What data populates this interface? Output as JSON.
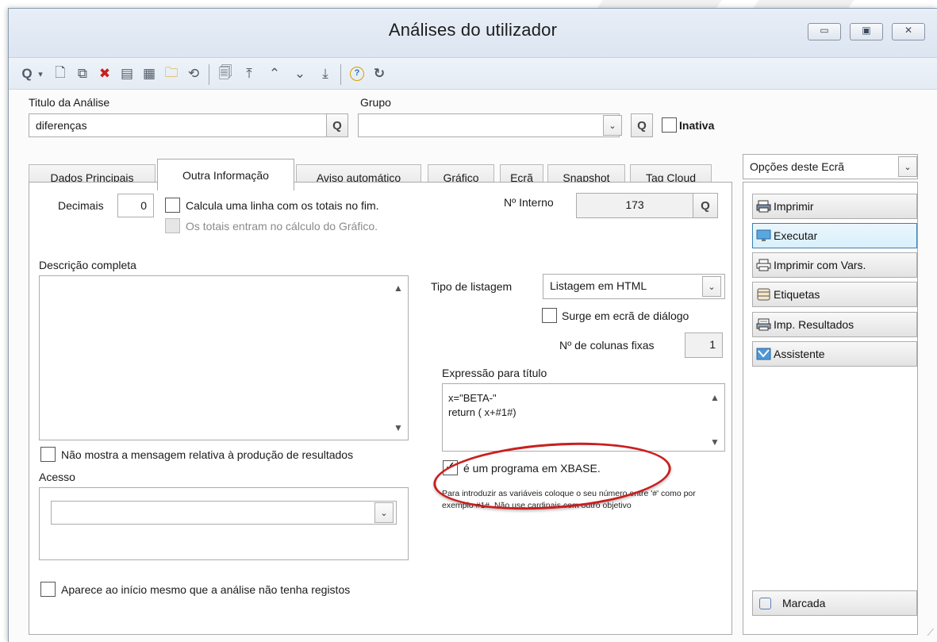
{
  "window": {
    "title": "Análises do utilizador",
    "minimize_glyph": "▭",
    "maximize_glyph": "▣",
    "close_glyph": "✕"
  },
  "toolbar": {
    "search_icon": "search-icon",
    "search_glyph": "Q",
    "dropdown_glyph": "▾",
    "new_glyph": "🗋",
    "copy_glyph": "⧉",
    "delete_glyph": "✖",
    "delete_color": "#c8201f",
    "list_glyph": "▤",
    "grid_glyph": "▦",
    "find_glyph": "🗀",
    "refresh_glyph": "⟲",
    "preview_glyph": "🗐",
    "first_glyph": "⤒",
    "prev_glyph": "⌃",
    "next_glyph": "⌄",
    "last_glyph": "⤓",
    "help_glyph": "?",
    "reload_glyph": "↻"
  },
  "form": {
    "titulo_label": "Titulo da Análise",
    "titulo_value": "diferenças",
    "grupo_label": "Grupo",
    "grupo_value": "",
    "inativa_label": "Inativa",
    "lookup_glyph": "Q",
    "combo_glyph": "⌄"
  },
  "tabs": [
    {
      "label": "Dados Principais"
    },
    {
      "label": "Outra Informação"
    },
    {
      "label": "Aviso automático"
    },
    {
      "label": "Gráfico"
    },
    {
      "label": "Ecrã"
    },
    {
      "label": "Snapshot"
    },
    {
      "label": "Tag Cloud"
    }
  ],
  "active_tab": "Outra Informação",
  "panel": {
    "decimais_label": "Decimais",
    "decimais_value": "0",
    "calcula_totais_label": "Calcula uma linha com os totais no fim.",
    "totais_grafico_label": "Os totais entram no cálculo do Gráfico.",
    "n_interno_label": "Nº Interno",
    "n_interno_value": "173",
    "descricao_label": "Descrição completa",
    "descricao_value": "",
    "tipo_listagem_label": "Tipo de listagem",
    "tipo_listagem_value": "Listagem em HTML",
    "surge_dialogo_label": "Surge em ecrã de diálogo",
    "colunas_fixas_label": "Nº de colunas fixas",
    "colunas_fixas_value": "1",
    "expressao_label": "Expressão para título",
    "expressao_line1": "x=\"BETA-\"",
    "expressao_line2": "return ( x+#1#)",
    "xbase_label": "é um programa em XBASE.",
    "xbase_checked": true,
    "xbase_check_glyph": "✓",
    "hint_text": "Para introduzir as variáveis coloque o seu número entre '#' como por exemplo #1#. Não use cardinais com outro objetivo",
    "nao_mostra_label": "Não mostra a mensagem relativa à produção de resultados",
    "acesso_label": "Acesso",
    "acesso_value": "",
    "aparece_inicio_label": "Aparece ao início mesmo que a análise não tenha registos",
    "highlight_color": "#c8201f"
  },
  "sidebar": {
    "options_label": "Opções deste Ecrã",
    "buttons": [
      {
        "label": "Imprimir",
        "icon": "printer-icon"
      },
      {
        "label": "Executar",
        "icon": "monitor-icon"
      },
      {
        "label": "Imprimir com Vars.",
        "icon": "printer-icon"
      },
      {
        "label": "Etiquetas",
        "icon": "labels-icon"
      },
      {
        "label": "Imp. Resultados",
        "icon": "print-results-icon"
      },
      {
        "label": "Assistente",
        "icon": "wizard-icon"
      }
    ],
    "marcada_label": "Marcada",
    "accent": "#3c7fb1"
  }
}
